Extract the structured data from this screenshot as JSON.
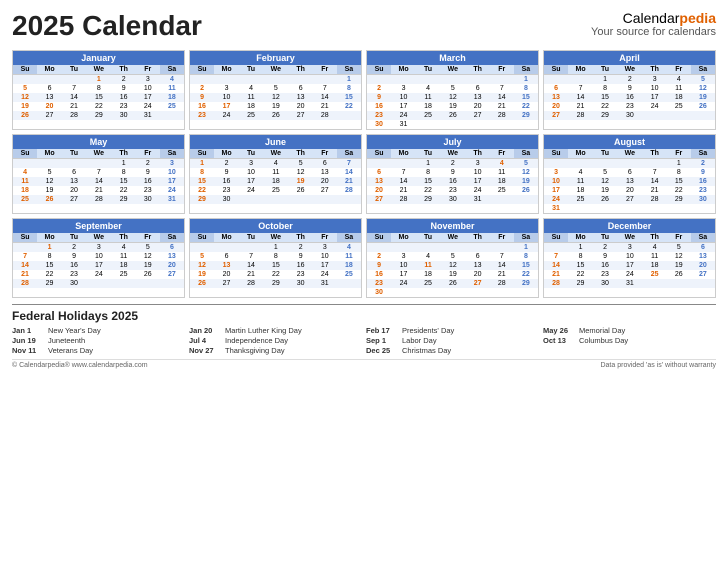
{
  "header": {
    "title": "2025 Calendar",
    "brand_name": "Calendar",
    "brand_accent": "pedia",
    "brand_tagline": "Your source for calendars"
  },
  "months": [
    {
      "name": "January",
      "weeks": [
        [
          "",
          "",
          "",
          "1",
          "2",
          "3",
          "4"
        ],
        [
          "5",
          "6",
          "7",
          "8",
          "9",
          "10",
          "11"
        ],
        [
          "12",
          "13",
          "14",
          "15",
          "16",
          "17",
          "18"
        ],
        [
          "19",
          "20",
          "21",
          "22",
          "23",
          "24",
          "25"
        ],
        [
          "26",
          "27",
          "28",
          "29",
          "30",
          "31",
          ""
        ]
      ],
      "holidays": [
        1,
        20
      ]
    },
    {
      "name": "February",
      "weeks": [
        [
          "",
          "",
          "",
          "",
          "",
          "",
          "1"
        ],
        [
          "2",
          "3",
          "4",
          "5",
          "6",
          "7",
          "8"
        ],
        [
          "9",
          "10",
          "11",
          "12",
          "13",
          "14",
          "15"
        ],
        [
          "16",
          "17",
          "18",
          "19",
          "20",
          "21",
          "22"
        ],
        [
          "23",
          "24",
          "25",
          "26",
          "27",
          "28",
          ""
        ]
      ],
      "holidays": [
        17
      ]
    },
    {
      "name": "March",
      "weeks": [
        [
          "",
          "",
          "",
          "",
          "",
          "",
          "1"
        ],
        [
          "2",
          "3",
          "4",
          "5",
          "6",
          "7",
          "8"
        ],
        [
          "9",
          "10",
          "11",
          "12",
          "13",
          "14",
          "15"
        ],
        [
          "16",
          "17",
          "18",
          "19",
          "20",
          "21",
          "22"
        ],
        [
          "23",
          "24",
          "25",
          "26",
          "27",
          "28",
          "29"
        ],
        [
          "30",
          "31",
          "",
          "",
          "",
          "",
          ""
        ]
      ],
      "holidays": []
    },
    {
      "name": "April",
      "weeks": [
        [
          "",
          "",
          "1",
          "2",
          "3",
          "4",
          "5"
        ],
        [
          "6",
          "7",
          "8",
          "9",
          "10",
          "11",
          "12"
        ],
        [
          "13",
          "14",
          "15",
          "16",
          "17",
          "18",
          "19"
        ],
        [
          "20",
          "21",
          "22",
          "23",
          "24",
          "25",
          "26"
        ],
        [
          "27",
          "28",
          "29",
          "30",
          "",
          "",
          ""
        ]
      ],
      "holidays": []
    },
    {
      "name": "May",
      "weeks": [
        [
          "",
          "",
          "",
          "",
          "1",
          "2",
          "3"
        ],
        [
          "4",
          "5",
          "6",
          "7",
          "8",
          "9",
          "10"
        ],
        [
          "11",
          "12",
          "13",
          "14",
          "15",
          "16",
          "17"
        ],
        [
          "18",
          "19",
          "20",
          "21",
          "22",
          "23",
          "24"
        ],
        [
          "25",
          "26",
          "27",
          "28",
          "29",
          "30",
          "31"
        ]
      ],
      "holidays": [
        26
      ]
    },
    {
      "name": "June",
      "weeks": [
        [
          "1",
          "2",
          "3",
          "4",
          "5",
          "6",
          "7"
        ],
        [
          "8",
          "9",
          "10",
          "11",
          "12",
          "13",
          "14"
        ],
        [
          "15",
          "16",
          "17",
          "18",
          "19",
          "20",
          "21"
        ],
        [
          "22",
          "23",
          "24",
          "25",
          "26",
          "27",
          "28"
        ],
        [
          "29",
          "30",
          "",
          "",
          "",
          "",
          ""
        ]
      ],
      "holidays": [
        19
      ]
    },
    {
      "name": "July",
      "weeks": [
        [
          "",
          "",
          "1",
          "2",
          "3",
          "4",
          "5"
        ],
        [
          "6",
          "7",
          "8",
          "9",
          "10",
          "11",
          "12"
        ],
        [
          "13",
          "14",
          "15",
          "16",
          "17",
          "18",
          "19"
        ],
        [
          "20",
          "21",
          "22",
          "23",
          "24",
          "25",
          "26"
        ],
        [
          "27",
          "28",
          "29",
          "30",
          "31",
          "",
          ""
        ]
      ],
      "holidays": [
        4
      ]
    },
    {
      "name": "August",
      "weeks": [
        [
          "",
          "",
          "",
          "",
          "",
          "1",
          "2"
        ],
        [
          "3",
          "4",
          "5",
          "6",
          "7",
          "8",
          "9"
        ],
        [
          "10",
          "11",
          "12",
          "13",
          "14",
          "15",
          "16"
        ],
        [
          "17",
          "18",
          "19",
          "20",
          "21",
          "22",
          "23"
        ],
        [
          "24",
          "25",
          "26",
          "27",
          "28",
          "29",
          "30"
        ],
        [
          "31",
          "",
          "",
          "",
          "",
          "",
          ""
        ]
      ],
      "holidays": []
    },
    {
      "name": "September",
      "weeks": [
        [
          "",
          "1",
          "2",
          "3",
          "4",
          "5",
          "6"
        ],
        [
          "7",
          "8",
          "9",
          "10",
          "11",
          "12",
          "13"
        ],
        [
          "14",
          "15",
          "16",
          "17",
          "18",
          "19",
          "20"
        ],
        [
          "21",
          "22",
          "23",
          "24",
          "25",
          "26",
          "27"
        ],
        [
          "28",
          "29",
          "30",
          "",
          "",
          "",
          ""
        ]
      ],
      "holidays": [
        1
      ]
    },
    {
      "name": "October",
      "weeks": [
        [
          "",
          "",
          "",
          "1",
          "2",
          "3",
          "4"
        ],
        [
          "5",
          "6",
          "7",
          "8",
          "9",
          "10",
          "11"
        ],
        [
          "12",
          "13",
          "14",
          "15",
          "16",
          "17",
          "18"
        ],
        [
          "19",
          "20",
          "21",
          "22",
          "23",
          "24",
          "25"
        ],
        [
          "26",
          "27",
          "28",
          "29",
          "30",
          "31",
          ""
        ]
      ],
      "holidays": [
        13
      ]
    },
    {
      "name": "November",
      "weeks": [
        [
          "",
          "",
          "",
          "",
          "",
          "",
          "1"
        ],
        [
          "2",
          "3",
          "4",
          "5",
          "6",
          "7",
          "8"
        ],
        [
          "9",
          "10",
          "11",
          "12",
          "13",
          "14",
          "15"
        ],
        [
          "16",
          "17",
          "18",
          "19",
          "20",
          "21",
          "22"
        ],
        [
          "23",
          "24",
          "25",
          "26",
          "27",
          "28",
          "29"
        ],
        [
          "30",
          "",
          "",
          "",
          "",
          "",
          ""
        ]
      ],
      "holidays": [
        11,
        27
      ]
    },
    {
      "name": "December",
      "weeks": [
        [
          "",
          "1",
          "2",
          "3",
          "4",
          "5",
          "6"
        ],
        [
          "7",
          "8",
          "9",
          "10",
          "11",
          "12",
          "13"
        ],
        [
          "14",
          "15",
          "16",
          "17",
          "18",
          "19",
          "20"
        ],
        [
          "21",
          "22",
          "23",
          "24",
          "25",
          "26",
          "27"
        ],
        [
          "28",
          "29",
          "30",
          "31",
          "",
          "",
          ""
        ]
      ],
      "holidays": [
        25
      ]
    }
  ],
  "holidays_title": "Federal Holidays 2025",
  "holidays": [
    {
      "date": "Jan 1",
      "name": "New Year's Day"
    },
    {
      "date": "Jan 20",
      "name": "Martin Luther King Day"
    },
    {
      "date": "Feb 17",
      "name": "Presidents' Day"
    },
    {
      "date": "May 26",
      "name": "Memorial Day"
    },
    {
      "date": "Jun 19",
      "name": "Juneteenth"
    },
    {
      "date": "Jul 4",
      "name": "Independence Day"
    },
    {
      "date": "Sep 1",
      "name": "Labor Day"
    },
    {
      "date": "Oct 13",
      "name": "Columbus Day"
    },
    {
      "date": "Nov 11",
      "name": "Veterans Day"
    },
    {
      "date": "Nov 27",
      "name": "Thanksgiving Day"
    },
    {
      "date": "Dec 25",
      "name": "Christmas Day"
    }
  ],
  "footer": {
    "left": "© Calendarpedia®  www.calendarpedia.com",
    "right": "Data provided 'as is' without warranty"
  }
}
